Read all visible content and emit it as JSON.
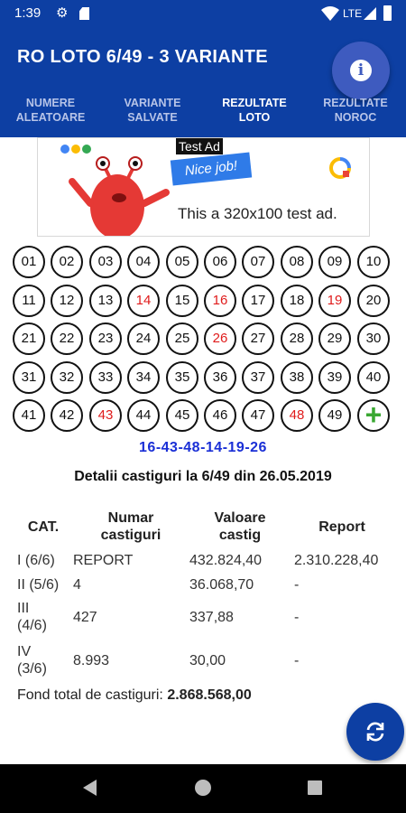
{
  "status_bar": {
    "time": "1:39",
    "network": "LTE"
  },
  "header": {
    "title": "RO LOTO 6/49 - 3 VARIANTE",
    "tabs": [
      {
        "line1": "NUMERE",
        "line2": "ALEATOARE",
        "active": false
      },
      {
        "line1": "VARIANTE",
        "line2": "SALVATE",
        "active": false
      },
      {
        "line1": "REZULTATE",
        "line2": "LOTO",
        "active": true
      },
      {
        "line1": "REZULTATE",
        "line2": "NOROC",
        "active": false
      }
    ]
  },
  "ad": {
    "label": "Test Ad",
    "badge": "Nice job!",
    "text": "This a 320x100 test ad."
  },
  "grid": {
    "numbers": [
      "01",
      "02",
      "03",
      "04",
      "05",
      "06",
      "07",
      "08",
      "09",
      "10",
      "11",
      "12",
      "13",
      "14",
      "15",
      "16",
      "17",
      "18",
      "19",
      "20",
      "21",
      "22",
      "23",
      "24",
      "25",
      "26",
      "27",
      "28",
      "29",
      "30",
      "31",
      "32",
      "33",
      "34",
      "35",
      "36",
      "37",
      "38",
      "39",
      "40",
      "41",
      "42",
      "43",
      "44",
      "45",
      "46",
      "47",
      "48",
      "49"
    ],
    "drawn": [
      "14",
      "16",
      "19",
      "26",
      "43",
      "48"
    ],
    "add_symbol": "+"
  },
  "draw": {
    "numbers": "16-43-48-14-19-26",
    "details_title": "Detalii castiguri la 6/49 din 26.05.2019"
  },
  "table": {
    "headers": {
      "cat": "CAT.",
      "numar_1": "Numar",
      "numar_2": "castiguri",
      "valoare_1": "Valoare",
      "valoare_2": "castig",
      "report": "Report"
    },
    "rows": [
      {
        "cat_1": "I (6/6)",
        "cat_2": "",
        "numar": "REPORT",
        "valoare": "432.824,40",
        "report": "2.310.228,40"
      },
      {
        "cat_1": "II (5/6)",
        "cat_2": "",
        "numar": "4",
        "valoare": "36.068,70",
        "report": "-"
      },
      {
        "cat_1": "III",
        "cat_2": "(4/6)",
        "numar": "427",
        "valoare": "337,88",
        "report": "-"
      },
      {
        "cat_1": "IV",
        "cat_2": "(3/6)",
        "numar": "8.993",
        "valoare": "30,00",
        "report": "-"
      }
    ],
    "fond_label": "Fond total de castiguri:",
    "fond_value": "2.868.568,00"
  },
  "colors": {
    "primary": "#0d3fa3",
    "drawn": "#e01b1b",
    "draw_numbers": "#1a2fd6",
    "add": "#3aa832"
  },
  "icons": {
    "info": "info-icon",
    "refresh": "refresh-icon",
    "settings": "gear-icon"
  }
}
